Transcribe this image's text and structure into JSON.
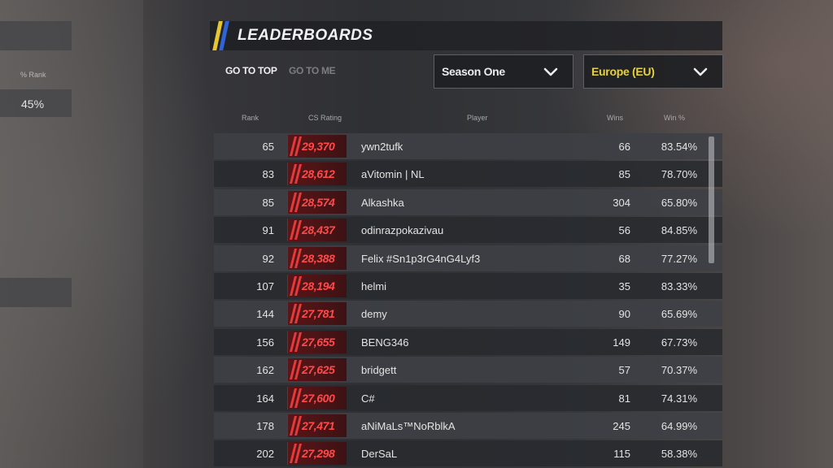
{
  "left_panel": {
    "column_label": "% Rank",
    "value": "45%"
  },
  "header": {
    "title": "LEADERBOARDS"
  },
  "nav": {
    "go_to_top": "GO TO TOP",
    "go_to_me": "GO TO ME"
  },
  "filters": {
    "season": "Season One",
    "region": "Europe (EU)"
  },
  "columns": {
    "rank": "Rank",
    "rating": "CS Rating",
    "player": "Player",
    "wins": "Wins",
    "win_pct": "Win %"
  },
  "rows": [
    {
      "rank": "65",
      "rating": "29,370",
      "player": "ywn2tufk",
      "wins": "66",
      "win_pct": "83.54%"
    },
    {
      "rank": "83",
      "rating": "28,612",
      "player": "aVitomin | NL",
      "wins": "85",
      "win_pct": "78.70%"
    },
    {
      "rank": "85",
      "rating": "28,574",
      "player": "Alkashka",
      "wins": "304",
      "win_pct": "65.80%"
    },
    {
      "rank": "91",
      "rating": "28,437",
      "player": "odinrazpokazivau",
      "wins": "56",
      "win_pct": "84.85%"
    },
    {
      "rank": "92",
      "rating": "28,388",
      "player": "Felix #Sn1p3rG4nG4Lyf3",
      "wins": "68",
      "win_pct": "77.27%"
    },
    {
      "rank": "107",
      "rating": "28,194",
      "player": "helmi",
      "wins": "35",
      "win_pct": "83.33%"
    },
    {
      "rank": "144",
      "rating": "27,781",
      "player": "demy",
      "wins": "90",
      "win_pct": "65.69%"
    },
    {
      "rank": "156",
      "rating": "27,655",
      "player": "BENG346",
      "wins": "149",
      "win_pct": "67.73%"
    },
    {
      "rank": "162",
      "rating": "27,625",
      "player": "bridgett",
      "wins": "57",
      "win_pct": "70.37%"
    },
    {
      "rank": "164",
      "rating": "27,600",
      "player": "C#",
      "wins": "81",
      "win_pct": "74.31%"
    },
    {
      "rank": "178",
      "rating": "27,471",
      "player": "aNiMaLs™NoRblkA",
      "wins": "245",
      "win_pct": "64.99%"
    },
    {
      "rank": "202",
      "rating": "27,298",
      "player": "DerSaL",
      "wins": "115",
      "win_pct": "58.38%"
    }
  ],
  "colors": {
    "accent_yellow": "#e6c533",
    "accent_blue": "#2f63d6",
    "rating_red": "#ff4a4a",
    "region_text": "#e6d23a"
  },
  "icons": {
    "dropdown": "chevron-down-icon"
  }
}
